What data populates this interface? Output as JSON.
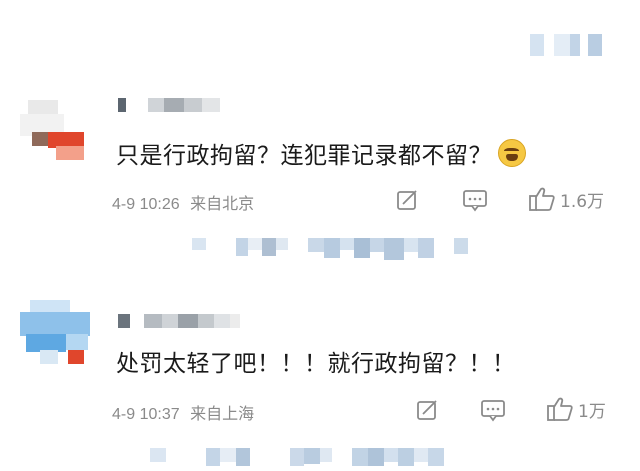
{
  "comments": [
    {
      "content": "只是行政拘留？连犯罪记录都不留？",
      "emoji": "crying-emoji",
      "time": "4-9 10:26",
      "location": "来自北京",
      "likes": "1.6万"
    },
    {
      "content": "处罚太轻了吧！！！就行政拘留？！！",
      "time": "4-9 10:37",
      "location": "来自上海",
      "likes": "1万"
    }
  ],
  "icons": {
    "share": "share-icon",
    "comment": "comment-icon",
    "like": "thumbs-up-icon"
  },
  "colors": {
    "text": "#1a1a1a",
    "meta": "#8a8a8a",
    "blur_light": "#dde8f3",
    "blur_mid": "#b7cbe0",
    "avatar_red": "#e0462c"
  }
}
